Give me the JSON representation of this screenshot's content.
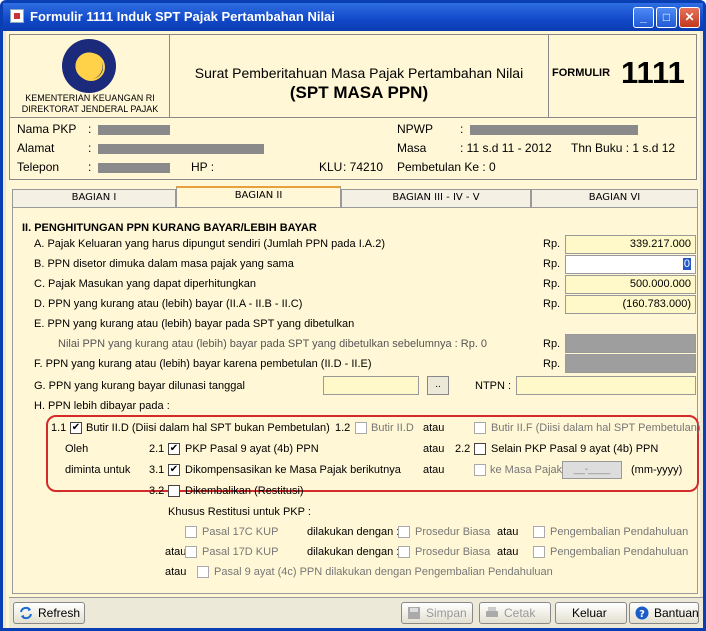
{
  "window": {
    "title": "Formulir 1111 Induk SPT Pajak Pertambahan Nilai"
  },
  "header": {
    "org1": "KEMENTERIAN KEUANGAN RI",
    "org2": "DIREKTORAT JENDERAL PAJAK",
    "title": "Surat Pemberitahuan Masa Pajak Pertambahan Nilai",
    "subtitle": "(SPT MASA PPN)",
    "form_label": "FORMULIR",
    "form_number": "1111"
  },
  "identity": {
    "nama_label": "Nama PKP",
    "nama_colon": ":",
    "alamat_label": "Alamat",
    "alamat_colon": ":",
    "telepon_label": "Telepon",
    "telepon_colon": ":",
    "hp_label": "HP :",
    "klu_label": "KLU",
    "klu_value": ": 74210",
    "npwp_label": "NPWP",
    "npwp_colon": ":",
    "masa_label": "Masa",
    "masa_value": ": 11 s.d 11 - 2012",
    "thn_buku": "Thn Buku : 1 s.d 12",
    "pembetulan": "Pembetulan Ke : 0"
  },
  "tabs": [
    "BAGIAN I",
    "BAGIAN II",
    "BAGIAN III - IV - V",
    "BAGIAN VI"
  ],
  "section": {
    "title": "II. PENGHITUNGAN PPN KURANG BAYAR/LEBIH BAYAR",
    "a": "A. Pajak Keluaran yang harus dipungut sendiri (Jumlah PPN pada I.A.2)",
    "b": "B. PPN disetor dimuka dalam masa pajak yang sama",
    "c": "C. Pajak Masukan yang dapat diperhitungkan",
    "d": "D. PPN yang kurang atau (lebih) bayar (II.A - II.B - II.C)",
    "e": "E. PPN yang kurang atau (lebih) bayar pada SPT yang dibetulkan",
    "e_sub": "Nilai PPN yang kurang atau (lebih) bayar pada SPT yang dibetulkan sebelumnya : Rp.  0",
    "f": "F. PPN yang kurang atau (lebih) bayar karena pembetulan (II.D - II.E)",
    "g": "G. PPN yang kurang bayar dilunasi tanggal",
    "h": "H. PPN lebih dibayar pada :",
    "rp": "Rp.",
    "ntpn": "NTPN :",
    "values": {
      "a": "339.217.000",
      "b": "0",
      "c": "500.000.000",
      "d": "(160.783.000)"
    },
    "dots": ".."
  },
  "options": {
    "n11": "1.1",
    "opt11": "Butir II.D (Diisi dalam hal SPT bukan Pembetulan)",
    "n12": "1.2",
    "opt12": "Butir II.D",
    "atau": "atau",
    "opt13": "Butir II.F (Diisi dalam hal SPT Pembetulan)",
    "oleh": "Oleh",
    "diminta": "diminta untuk",
    "n21": "2.1",
    "opt21": "PKP Pasal 9 ayat (4b) PPN",
    "n22": "2.2",
    "opt22": "Selain PKP Pasal 9 ayat (4b) PPN",
    "n31": "3.1",
    "opt31": "Dikompensasikan ke Masa Pajak berikutnya",
    "opt33": "ke Masa Pajak",
    "date_placeholder": "__-____",
    "date_fmt": "(mm-yyyy)",
    "n32": "3.2",
    "opt32": "Dikembalikan (Restitusi)"
  },
  "restitusi": {
    "title": "Khusus Restitusi untuk PKP :",
    "p17c": "Pasal 17C KUP",
    "p17d": "Pasal 17D KUP",
    "dilakukan": "dilakukan dengan :",
    "prosedur": "Prosedur Biasa",
    "pengembalian": "Pengembalian Pendahuluan",
    "atau": "atau",
    "p9": "Pasal 9 ayat (4c) PPN dilakukan dengan Pengembalian Pendahuluan"
  },
  "buttons": {
    "refresh": "Refresh",
    "simpan": "Simpan",
    "cetak": "Cetak",
    "keluar": "Keluar",
    "bantuan": "Bantuan"
  }
}
